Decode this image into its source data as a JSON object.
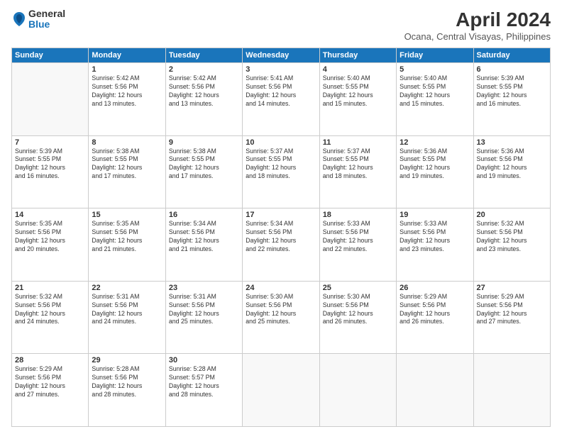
{
  "header": {
    "logo": {
      "general": "General",
      "blue": "Blue"
    },
    "title": "April 2024",
    "location": "Ocana, Central Visayas, Philippines"
  },
  "days_of_week": [
    "Sunday",
    "Monday",
    "Tuesday",
    "Wednesday",
    "Thursday",
    "Friday",
    "Saturday"
  ],
  "weeks": [
    [
      {
        "day": "",
        "info": ""
      },
      {
        "day": "1",
        "info": "Sunrise: 5:42 AM\nSunset: 5:56 PM\nDaylight: 12 hours\nand 13 minutes."
      },
      {
        "day": "2",
        "info": "Sunrise: 5:42 AM\nSunset: 5:56 PM\nDaylight: 12 hours\nand 13 minutes."
      },
      {
        "day": "3",
        "info": "Sunrise: 5:41 AM\nSunset: 5:56 PM\nDaylight: 12 hours\nand 14 minutes."
      },
      {
        "day": "4",
        "info": "Sunrise: 5:40 AM\nSunset: 5:55 PM\nDaylight: 12 hours\nand 15 minutes."
      },
      {
        "day": "5",
        "info": "Sunrise: 5:40 AM\nSunset: 5:55 PM\nDaylight: 12 hours\nand 15 minutes."
      },
      {
        "day": "6",
        "info": "Sunrise: 5:39 AM\nSunset: 5:55 PM\nDaylight: 12 hours\nand 16 minutes."
      }
    ],
    [
      {
        "day": "7",
        "info": "Sunrise: 5:39 AM\nSunset: 5:55 PM\nDaylight: 12 hours\nand 16 minutes."
      },
      {
        "day": "8",
        "info": "Sunrise: 5:38 AM\nSunset: 5:55 PM\nDaylight: 12 hours\nand 17 minutes."
      },
      {
        "day": "9",
        "info": "Sunrise: 5:38 AM\nSunset: 5:55 PM\nDaylight: 12 hours\nand 17 minutes."
      },
      {
        "day": "10",
        "info": "Sunrise: 5:37 AM\nSunset: 5:55 PM\nDaylight: 12 hours\nand 18 minutes."
      },
      {
        "day": "11",
        "info": "Sunrise: 5:37 AM\nSunset: 5:55 PM\nDaylight: 12 hours\nand 18 minutes."
      },
      {
        "day": "12",
        "info": "Sunrise: 5:36 AM\nSunset: 5:55 PM\nDaylight: 12 hours\nand 19 minutes."
      },
      {
        "day": "13",
        "info": "Sunrise: 5:36 AM\nSunset: 5:56 PM\nDaylight: 12 hours\nand 19 minutes."
      }
    ],
    [
      {
        "day": "14",
        "info": "Sunrise: 5:35 AM\nSunset: 5:56 PM\nDaylight: 12 hours\nand 20 minutes."
      },
      {
        "day": "15",
        "info": "Sunrise: 5:35 AM\nSunset: 5:56 PM\nDaylight: 12 hours\nand 21 minutes."
      },
      {
        "day": "16",
        "info": "Sunrise: 5:34 AM\nSunset: 5:56 PM\nDaylight: 12 hours\nand 21 minutes."
      },
      {
        "day": "17",
        "info": "Sunrise: 5:34 AM\nSunset: 5:56 PM\nDaylight: 12 hours\nand 22 minutes."
      },
      {
        "day": "18",
        "info": "Sunrise: 5:33 AM\nSunset: 5:56 PM\nDaylight: 12 hours\nand 22 minutes."
      },
      {
        "day": "19",
        "info": "Sunrise: 5:33 AM\nSunset: 5:56 PM\nDaylight: 12 hours\nand 23 minutes."
      },
      {
        "day": "20",
        "info": "Sunrise: 5:32 AM\nSunset: 5:56 PM\nDaylight: 12 hours\nand 23 minutes."
      }
    ],
    [
      {
        "day": "21",
        "info": "Sunrise: 5:32 AM\nSunset: 5:56 PM\nDaylight: 12 hours\nand 24 minutes."
      },
      {
        "day": "22",
        "info": "Sunrise: 5:31 AM\nSunset: 5:56 PM\nDaylight: 12 hours\nand 24 minutes."
      },
      {
        "day": "23",
        "info": "Sunrise: 5:31 AM\nSunset: 5:56 PM\nDaylight: 12 hours\nand 25 minutes."
      },
      {
        "day": "24",
        "info": "Sunrise: 5:30 AM\nSunset: 5:56 PM\nDaylight: 12 hours\nand 25 minutes."
      },
      {
        "day": "25",
        "info": "Sunrise: 5:30 AM\nSunset: 5:56 PM\nDaylight: 12 hours\nand 26 minutes."
      },
      {
        "day": "26",
        "info": "Sunrise: 5:29 AM\nSunset: 5:56 PM\nDaylight: 12 hours\nand 26 minutes."
      },
      {
        "day": "27",
        "info": "Sunrise: 5:29 AM\nSunset: 5:56 PM\nDaylight: 12 hours\nand 27 minutes."
      }
    ],
    [
      {
        "day": "28",
        "info": "Sunrise: 5:29 AM\nSunset: 5:56 PM\nDaylight: 12 hours\nand 27 minutes."
      },
      {
        "day": "29",
        "info": "Sunrise: 5:28 AM\nSunset: 5:56 PM\nDaylight: 12 hours\nand 28 minutes."
      },
      {
        "day": "30",
        "info": "Sunrise: 5:28 AM\nSunset: 5:57 PM\nDaylight: 12 hours\nand 28 minutes."
      },
      {
        "day": "",
        "info": ""
      },
      {
        "day": "",
        "info": ""
      },
      {
        "day": "",
        "info": ""
      },
      {
        "day": "",
        "info": ""
      }
    ]
  ]
}
